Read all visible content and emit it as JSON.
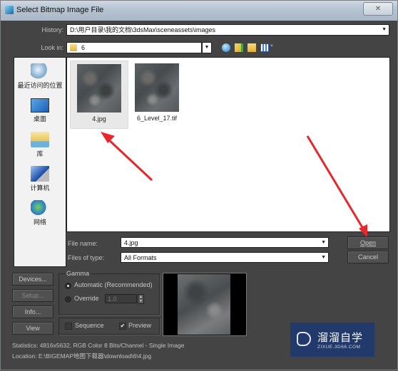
{
  "window": {
    "title": "Select Bitmap Image File",
    "close_label": "✕"
  },
  "history": {
    "label": "History:",
    "value": "D:\\用户目录\\我的文档\\3dsMax\\sceneassets\\images"
  },
  "lookin": {
    "label": "Look in:",
    "value": "6"
  },
  "toolbar": {
    "icons": [
      "back-icon",
      "up-folder-icon",
      "new-folder-icon",
      "view-menu-icon"
    ]
  },
  "places": [
    {
      "label": "最近访问的位置",
      "icon": "recent-places-icon"
    },
    {
      "label": "桌面",
      "icon": "desktop-icon"
    },
    {
      "label": "库",
      "icon": "libraries-icon"
    },
    {
      "label": "计算机",
      "icon": "computer-icon"
    },
    {
      "label": "网络",
      "icon": "network-icon"
    }
  ],
  "files": [
    {
      "name": "4.jpg",
      "selected": true
    },
    {
      "name": "6_Level_17.tif",
      "selected": false
    }
  ],
  "filename": {
    "label": "File name:",
    "value": "4.jpg"
  },
  "filetype": {
    "label": "Files of type:",
    "value": "All Formats"
  },
  "buttons": {
    "open": "Open",
    "cancel": "Cancel",
    "devices": "Devices...",
    "setup": "Setup...",
    "info": "Info...",
    "view": "View"
  },
  "gamma": {
    "title": "Gamma",
    "automatic": "Automatic (Recommended)",
    "override": "Override",
    "override_value": "1.0",
    "selected": "automatic"
  },
  "options": {
    "sequence": "Sequence",
    "sequence_checked": false,
    "preview": "Preview",
    "preview_checked": true
  },
  "statistics": "Statistics:  4816x5632, RGB Color 8 Bits/Channel - Single Image",
  "location": "Location:  E:\\BIGEMAP地图下载器\\download\\6\\4.jpg",
  "watermark": {
    "title": "溜溜自学",
    "subtitle": "ZIXUE.3D66.COM"
  },
  "colors": {
    "annotation_arrow": "#e8262b",
    "watermark_bg": "#223a6b",
    "dialog_bg": "#444444"
  }
}
